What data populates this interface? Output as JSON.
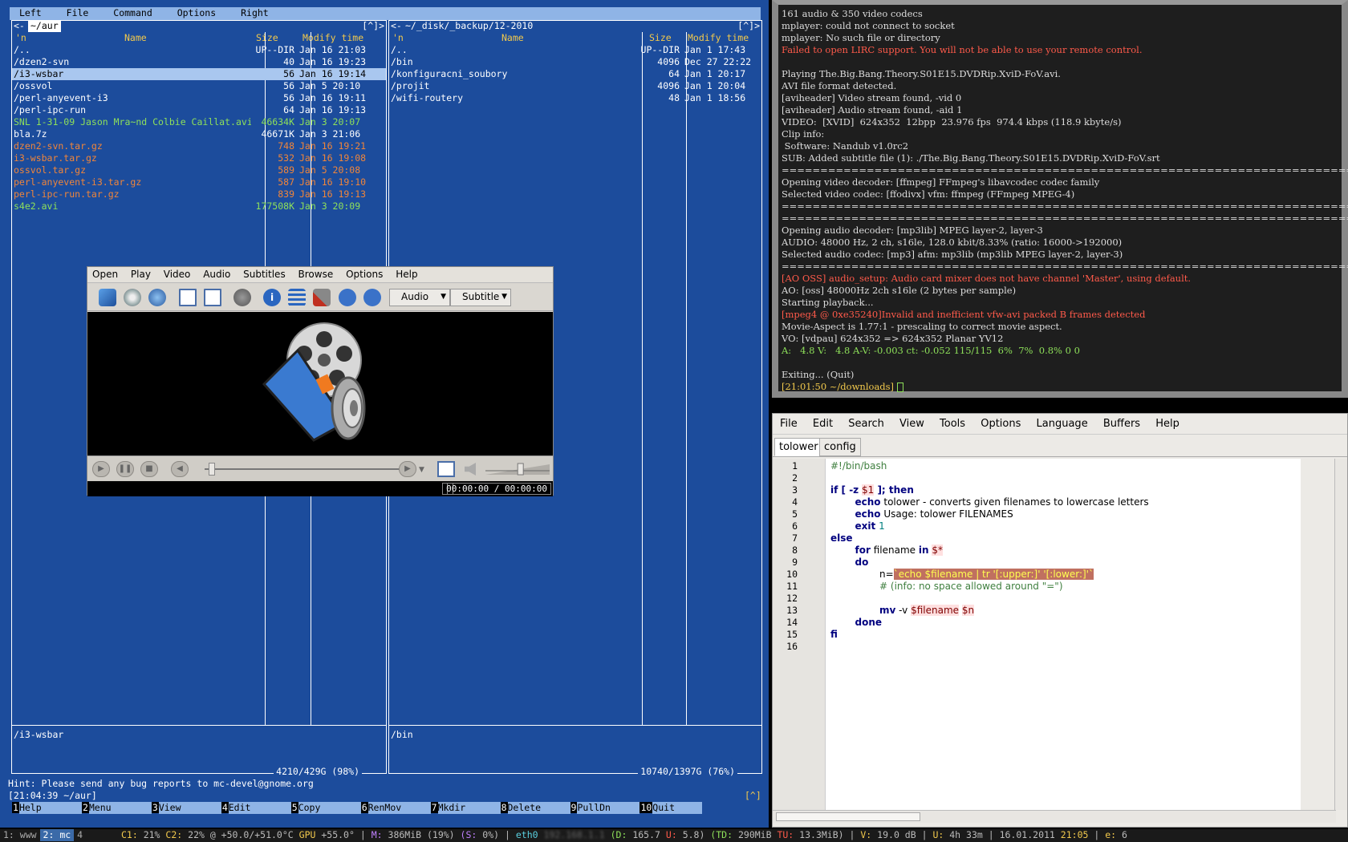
{
  "mc": {
    "menu": [
      "Left",
      "File",
      "Command",
      "Options",
      "Right"
    ],
    "left": {
      "path": "~/aur",
      "corner": "[^]>",
      "cols": {
        "n": "'n",
        "name": "Name",
        "size": "Size",
        "mtime": "Modify time"
      },
      "rows": [
        {
          "name": "/..",
          "size": "UP--DIR",
          "time": "Jan 16 21:03",
          "type": "dir"
        },
        {
          "name": "/dzen2-svn",
          "size": "40",
          "time": "Jan 16 19:23",
          "type": "dir"
        },
        {
          "name": "/i3-wsbar",
          "size": "56",
          "time": "Jan 16 19:14",
          "type": "sel"
        },
        {
          "name": "/ossvol",
          "size": "56",
          "time": "Jan  5 20:10",
          "type": "dir"
        },
        {
          "name": "/perl-anyevent-i3",
          "size": "56",
          "time": "Jan 16 19:11",
          "type": "dir"
        },
        {
          "name": "/perl-ipc-run",
          "size": "64",
          "time": "Jan 16 19:13",
          "type": "dir"
        },
        {
          "name": " SNL 1-31-09 Jason Mra~nd Colbie Caillat.avi",
          "size": "46634K",
          "time": "Jan  3 20:07",
          "type": "exe"
        },
        {
          "name": " bla.7z",
          "size": "46671K",
          "time": "Jan  3 21:06",
          "type": "dir"
        },
        {
          "name": " dzen2-svn.tar.gz",
          "size": "748",
          "time": "Jan 16 19:21",
          "type": "arc"
        },
        {
          "name": " i3-wsbar.tar.gz",
          "size": "532",
          "time": "Jan 16 19:08",
          "type": "arc"
        },
        {
          "name": " ossvol.tar.gz",
          "size": "589",
          "time": "Jan  5 20:08",
          "type": "arc"
        },
        {
          "name": " perl-anyevent-i3.tar.gz",
          "size": "587",
          "time": "Jan 16 19:10",
          "type": "arc"
        },
        {
          "name": " perl-ipc-run.tar.gz",
          "size": "839",
          "time": "Jan 16 19:13",
          "type": "arc"
        },
        {
          "name": " s4e2.avi",
          "size": "177508K",
          "time": "Jan  3 20:09",
          "type": "exe"
        }
      ],
      "footer": "/i3-wsbar",
      "stat": "4210/429G (98%)"
    },
    "right": {
      "path": "~/_disk/_backup/12-2010",
      "corner": "[^]>",
      "cols": {
        "n": "'n",
        "name": "Name",
        "size": "Size",
        "mtime": "Modify time"
      },
      "rows": [
        {
          "name": "/..",
          "size": "UP--DIR",
          "time": "Jan  1 17:43",
          "type": "dir"
        },
        {
          "name": "/bin",
          "size": "4096",
          "time": "Dec 27 22:22",
          "type": "dir"
        },
        {
          "name": "/konfiguracni_soubory",
          "size": "64",
          "time": "Jan  1 20:17",
          "type": "dir"
        },
        {
          "name": "/projit",
          "size": "4096",
          "time": "Jan  1 20:04",
          "type": "dir"
        },
        {
          "name": "/wifi-routery",
          "size": "48",
          "time": "Jan  1 18:56",
          "type": "dir"
        }
      ],
      "footer": "/bin",
      "stat": "10740/1397G (76%)"
    },
    "hint": "Hint: Please send any bug reports to mc-devel@gnome.org",
    "cmdline": "[21:04:39 ~/aur]",
    "cmdbtn": "[^]",
    "fkeys": [
      {
        "n": "1",
        "l": "Help"
      },
      {
        "n": "2",
        "l": "Menu"
      },
      {
        "n": "3",
        "l": "View"
      },
      {
        "n": "4",
        "l": "Edit"
      },
      {
        "n": "5",
        "l": "Copy"
      },
      {
        "n": "6",
        "l": "RenMov"
      },
      {
        "n": "7",
        "l": "Mkdir"
      },
      {
        "n": "8",
        "l": "Delete"
      },
      {
        "n": "9",
        "l": "PullDn"
      },
      {
        "n": "10",
        "l": "Quit"
      }
    ]
  },
  "smplayer": {
    "menu": [
      "Open",
      "Play",
      "Video",
      "Audio",
      "Subtitles",
      "Browse",
      "Options",
      "Help"
    ],
    "audio_dd": "Audio",
    "subtitle_dd": "Subtitle",
    "time": "00:00:00 / 00:00:00",
    "seek_fraction": 0.02,
    "volume_fraction": 0.55
  },
  "terminal": {
    "lines": [
      {
        "t": "161 audio & 350 video codecs",
        "c": ""
      },
      {
        "t": "mplayer: could not connect to socket",
        "c": ""
      },
      {
        "t": "mplayer: No such file or directory",
        "c": ""
      },
      {
        "t": "Failed to open LIRC support. You will not be able to use your remote control.",
        "c": "red"
      },
      {
        "t": "",
        "c": ""
      },
      {
        "t": "Playing The.Big.Bang.Theory.S01E15.DVDRip.XviD-FoV.avi.",
        "c": ""
      },
      {
        "t": "AVI file format detected.",
        "c": ""
      },
      {
        "t": "[aviheader] Video stream found, -vid 0",
        "c": ""
      },
      {
        "t": "[aviheader] Audio stream found, -aid 1",
        "c": ""
      },
      {
        "t": "VIDEO:  [XVID]  624x352  12bpp  23.976 fps  974.4 kbps (118.9 kbyte/s)",
        "c": ""
      },
      {
        "t": "Clip info:",
        "c": ""
      },
      {
        "t": " Software: Nandub v1.0rc2",
        "c": ""
      },
      {
        "t": "SUB: Added subtitle file (1): ./The.Big.Bang.Theory.S01E15.DVDRip.XviD-FoV.srt",
        "c": ""
      },
      {
        "t": "==========================================================================",
        "c": ""
      },
      {
        "t": "Opening video decoder: [ffmpeg] FFmpeg's libavcodec codec family",
        "c": ""
      },
      {
        "t": "Selected video codec: [ffodivx] vfm: ffmpeg (FFmpeg MPEG-4)",
        "c": ""
      },
      {
        "t": "==========================================================================",
        "c": ""
      },
      {
        "t": "==========================================================================",
        "c": ""
      },
      {
        "t": "Opening audio decoder: [mp3lib] MPEG layer-2, layer-3",
        "c": ""
      },
      {
        "t": "AUDIO: 48000 Hz, 2 ch, s16le, 128.0 kbit/8.33% (ratio: 16000->192000)",
        "c": ""
      },
      {
        "t": "Selected audio codec: [mp3] afm: mp3lib (mp3lib MPEG layer-2, layer-3)",
        "c": ""
      },
      {
        "t": "==========================================================================",
        "c": ""
      },
      {
        "t": "[AO OSS] audio_setup: Audio card mixer does not have channel 'Master', using default.",
        "c": "red"
      },
      {
        "t": "AO: [oss] 48000Hz 2ch s16le (2 bytes per sample)",
        "c": ""
      },
      {
        "t": "Starting playback...",
        "c": ""
      },
      {
        "t": "[mpeg4 @ 0xe35240]Invalid and inefficient vfw-avi packed B frames detected",
        "c": "red"
      },
      {
        "t": "Movie-Aspect is 1.77:1 - prescaling to correct movie aspect.",
        "c": ""
      },
      {
        "t": "VO: [vdpau] 624x352 => 624x352 Planar YV12",
        "c": ""
      },
      {
        "t": "A:   4.8 V:   4.8 A-V: -0.003 ct: -0.052 115/115  6%  7%  0.8% 0 0",
        "c": "grn"
      },
      {
        "t": "",
        "c": ""
      },
      {
        "t": "Exiting... (Quit)",
        "c": ""
      }
    ],
    "prompt": "[21:01:50 ~/downloads]"
  },
  "editor": {
    "menu": [
      "File",
      "Edit",
      "Search",
      "View",
      "Tools",
      "Options",
      "Language",
      "Buffers",
      "Help"
    ],
    "tabs": [
      "tolower",
      "config"
    ],
    "code": {
      "l1": "#!/bin/bash",
      "l3a": "if",
      "l3b": " [ ",
      "l3c": "-z",
      "l3d": "$1",
      "l3e": " ]; ",
      "l3f": "then",
      "l4a": "echo",
      "l4b": " tolower - converts given filenames to lowercase letters",
      "l5a": "echo",
      "l5b": " Usage: tolower FILENAMES",
      "l6a": "exit",
      "l6b": "1",
      "l7": "else",
      "l8a": "for",
      "l8b": " filename ",
      "l8c": "in",
      "l8d": "$*",
      "l9": "do",
      "l10a": "n=",
      "l10b": "`echo $filename | tr '[:upper:]' '[:lower:]'`",
      "l11": "# (info: no space allowed around \"=\")",
      "l13a": "mv",
      "l13b": " -v ",
      "l13c": "$filename",
      "l13d": "$n",
      "l14": "done",
      "l15": "fi"
    }
  },
  "statusbar": {
    "ws1": "1: www",
    "ws2": "2: mc",
    "ws3": "4",
    "c1l": "C1:",
    "c1v": "21%",
    "c2l": "C2:",
    "c2v": "22% @ +50.0/+51.0°C",
    "gpul": "GPU",
    "gpuv": "+55.0°",
    "meml": "M:",
    "memv": "386MiB (19%)",
    "swl": "(S:",
    "swv": "0%)",
    "eth": "eth0",
    "ip": "192.168.1.1",
    "dl": "(D:",
    "dv": "165.7",
    "ul": "U:",
    "uv": "5.8)",
    "tdl": "(TD:",
    "tdv": "290MiB",
    "tul": "TU:",
    "tuv": "13.3MiB)",
    "vl": "V:",
    "vv": "19.0 dB",
    "upl": "U:",
    "upv": "4h 33m",
    "date": "16.01.2011",
    "time": "21:05",
    "el": "e:",
    "ev": "6"
  }
}
